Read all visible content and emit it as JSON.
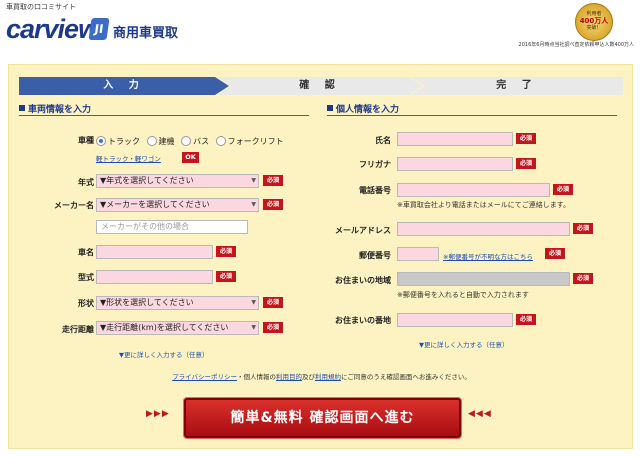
{
  "header": {
    "site_tag": "車買取の口コミサイト",
    "logo_text": "carview",
    "logo_badge": "JI",
    "service_title": "商用車買取",
    "medal_line1": "利用者",
    "medal_line2": "400万人",
    "medal_line3": "突破！",
    "stat_note": "2016年6月時点当社調べ査定依頼申込人数400万人"
  },
  "steps": [
    "入 力",
    "確 認",
    "完 了"
  ],
  "vehicle": {
    "title": "車両情報を入力",
    "type_label": "車種",
    "type_options": [
      "トラック",
      "建機",
      "バス",
      "フォークリフト"
    ],
    "type_selected": "トラック",
    "light_link": "軽トラック・軽ワゴン",
    "ok": "OK",
    "year_label": "年式",
    "year_value": "▼年式を選択してください",
    "maker_label": "メーカー名",
    "maker_value": "▼メーカーを選択してください",
    "maker_other_placeholder": "メーカーがその他の場合",
    "name_label": "車名",
    "model_label": "型式",
    "shape_label": "形状",
    "shape_value": "▼形状を選択してください",
    "mileage_label": "走行距離",
    "mileage_value": "▼走行距離(km)を選択してください",
    "more_link": "▼更に詳しく入力する（任意）"
  },
  "personal": {
    "title": "個人情報を入力",
    "name_label": "氏名",
    "kana_label": "フリガナ",
    "phone_label": "電話番号",
    "phone_note": "※車買取会社より電話またはメールにてご連絡します。",
    "email_label": "メールアドレス",
    "zip_label": "郵便番号",
    "zip_link": "※郵便番号が不明な方はこちら",
    "area_label": "お住まいの地域",
    "area_note": "※郵便番号を入れると自動で入力されます",
    "address_label": "お住まいの番地",
    "more_link": "▼更に詳しく入力する（任意）"
  },
  "required": "必須",
  "agree": {
    "privacy": "プライバシーポリシー",
    "text1": "・個人情報の",
    "purpose": "利用目的",
    "text2": "及び",
    "terms": "利用規約",
    "text3": "にご同意のうえ確認画面へお進みください。"
  },
  "submit_label": "簡単&無料 確認画面へ進む",
  "arrows_left": "▶▶▶",
  "arrows_right": "◀◀◀"
}
